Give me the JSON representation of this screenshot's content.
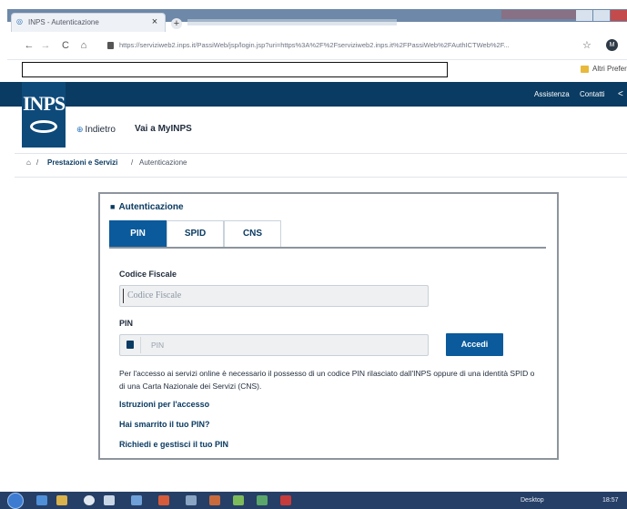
{
  "browser": {
    "tab_title": "INPS - Autenticazione",
    "tab_close": "×",
    "new_tab": "+",
    "url": "https://serviziweb2.inps.it/PassiWeb/jsp/login.jsp?uri=https%3A%2F%2Fserviziweb2.inps.it%2FPassiWeb%2FAuthICTWeb%2F...",
    "bookmark_label": "Altri Preferiti",
    "profile_initial": "M",
    "back": "←",
    "forward": "→",
    "reload": "C",
    "home": "⌂",
    "star": "☆"
  },
  "site": {
    "logo_text": "INPS",
    "nav": [
      "Assistenza",
      "Contatti"
    ],
    "share_icon": "share-icon",
    "back_label": "Indietro",
    "myinps_label": "Vai a MyINPS",
    "breadcrumb": [
      "Prestazioni e Servizi",
      "Autenticazione"
    ],
    "breadcrumb_sep": "/"
  },
  "auth": {
    "title": "Autenticazione",
    "tabs": [
      {
        "label": "PIN",
        "active": true
      },
      {
        "label": "SPID",
        "active": false
      },
      {
        "label": "CNS",
        "active": false
      }
    ],
    "cf_label": "Codice Fiscale",
    "cf_placeholder": "Codice Fiscale",
    "pin_label": "PIN",
    "pin_placeholder": "PIN",
    "submit_label": "Accedi",
    "info_text": "Per l'accesso ai servizi online è necessario il possesso di un codice PIN rilasciato dall'INPS oppure di una identità SPID o di una Carta Nazionale dei Servizi (CNS).",
    "links": [
      "Istruzioni per l'accesso",
      "Hai smarrito il tuo PIN?",
      "Richiedi e gestisci il tuo PIN"
    ]
  },
  "taskbar": {
    "desktop_label": "Desktop",
    "clock": "18:57"
  },
  "colors": {
    "brand_dark": "#0a3b62",
    "brand_primary": "#0a5a9c",
    "taskbar": "#263f66"
  }
}
